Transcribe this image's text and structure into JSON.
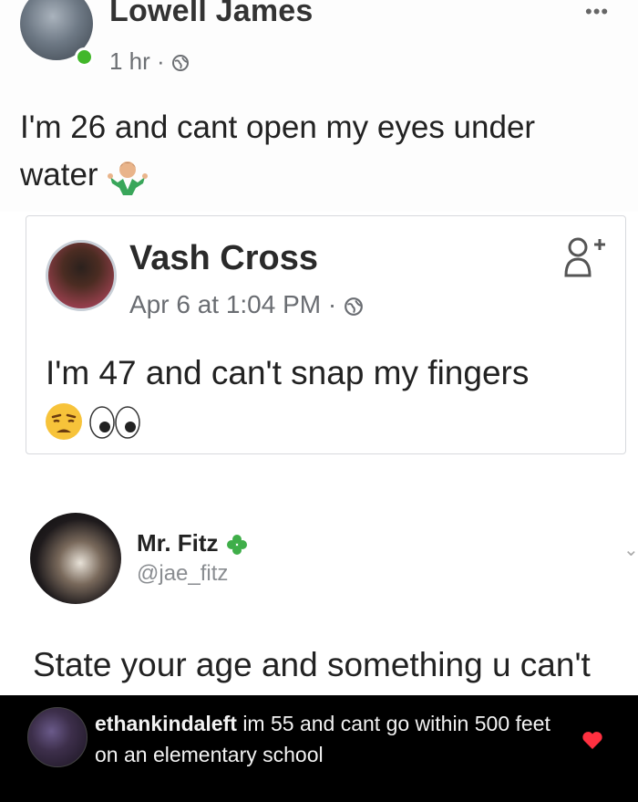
{
  "post": {
    "author": "Lowell James",
    "time": "1 hr",
    "separator": "·",
    "text_line1": "I'm 26 and cant open my eyes under",
    "text_line2": "water",
    "more": "•••"
  },
  "shared_post": {
    "author": "Vash Cross",
    "time": "Apr 6 at 1:04 PM",
    "separator": "·",
    "text": "I'm 47 and can't snap my fingers"
  },
  "tweet": {
    "author": "Mr. Fitz",
    "handle": "@jae_fitz",
    "text": "State your age and something u can't",
    "chevron": "⌄"
  },
  "comment": {
    "username": "ethankindaleft",
    "text": "im 55 and cant go within 500 feet on an elementary school"
  },
  "colors": {
    "online": "#42b72a",
    "heart": "#ff3040",
    "comment_bg": "#000000"
  },
  "icons": [
    "globe-icon",
    "shrug-emoji",
    "weary-emoji",
    "eyes-emoji",
    "four-leaf-clover-icon",
    "add-friend-icon",
    "heart-icon"
  ]
}
